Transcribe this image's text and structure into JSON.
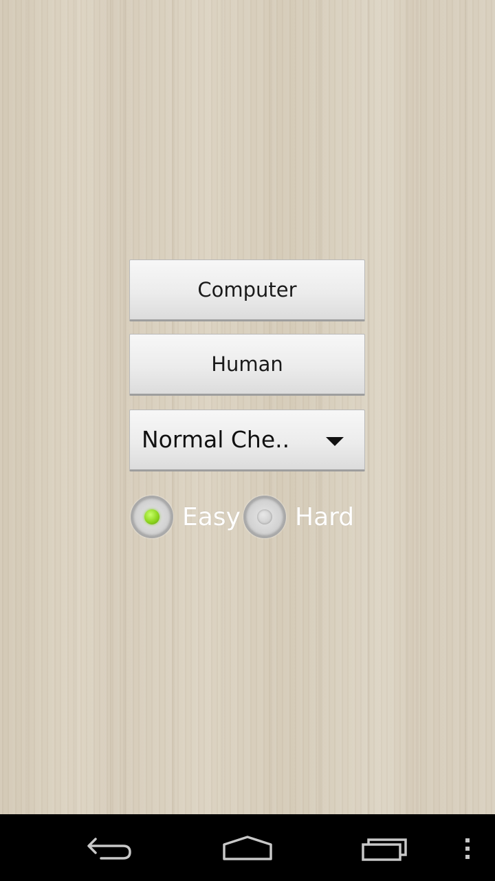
{
  "menu": {
    "computer_label": "Computer",
    "human_label": "Human",
    "variant_selected": "Normal Che..",
    "difficulty": {
      "easy_label": "Easy",
      "hard_label": "Hard",
      "selected": "Easy"
    }
  },
  "navbar": {
    "back_icon": "back-icon",
    "home_icon": "home-icon",
    "recents_icon": "recents-icon",
    "menu_icon": "overflow-menu-icon"
  },
  "colors": {
    "radio_selected": "#8ed61f",
    "navbar_background": "#000000"
  }
}
